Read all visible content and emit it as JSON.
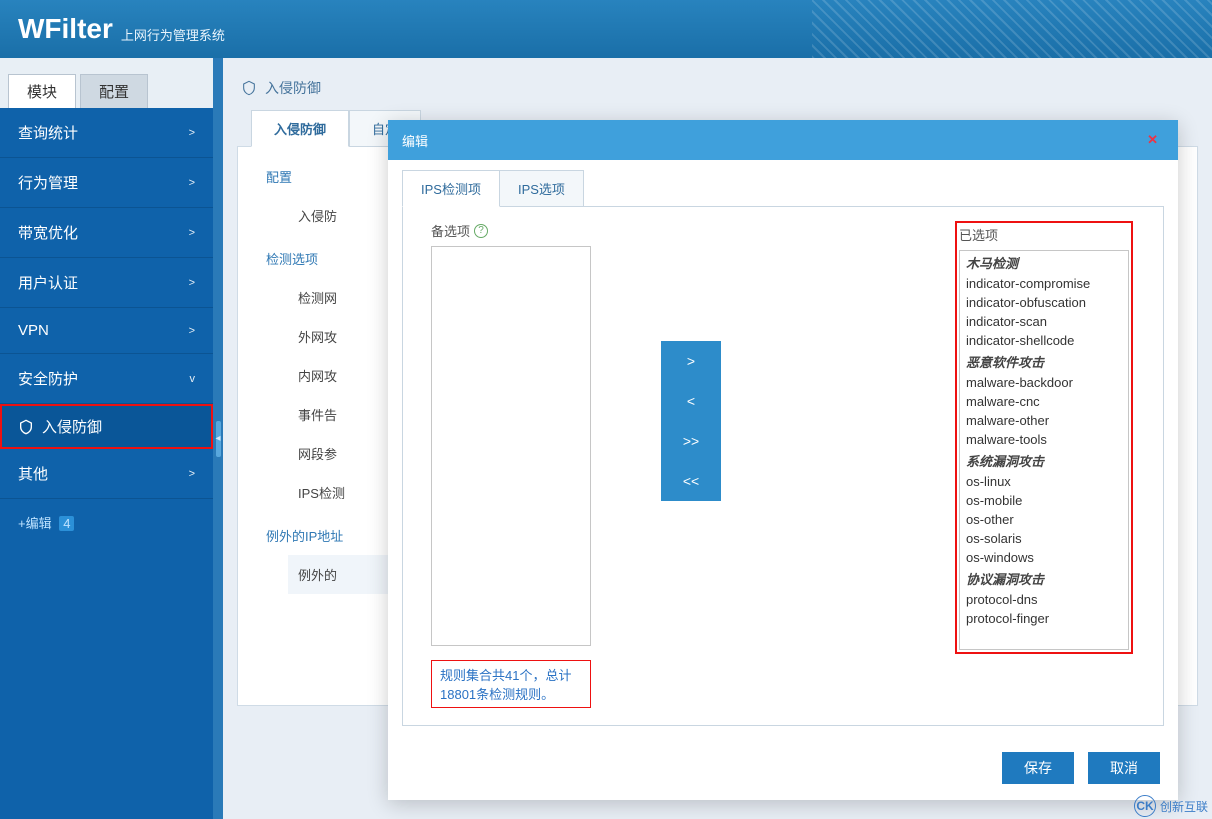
{
  "header": {
    "brand": "WFilter",
    "subtitle": "上网行为管理系统"
  },
  "side_tabs": {
    "modules": "模块",
    "config": "配置"
  },
  "menu": {
    "query": "查询统计",
    "behavior": "行为管理",
    "bandwidth": "带宽优化",
    "auth": "用户认证",
    "vpn": "VPN",
    "security": "安全防护",
    "security_sub_intrusion": "入侵防御",
    "other": "其他",
    "edit": "+编辑",
    "edit_badge": "4"
  },
  "chevron_right": ">",
  "chevron_down": "v",
  "breadcrumb": "入侵防御",
  "page_tabs": {
    "intrusion": "入侵防御",
    "custom": "自定"
  },
  "panel": {
    "section_config": "配置",
    "line_intrusion": "入侵防",
    "section_detect": "检测选项",
    "line_net": "检测网",
    "line_ext": "外网攻",
    "line_int": "内网攻",
    "line_event": "事件告",
    "line_seg": "网段参",
    "line_ips": "IPS检测",
    "section_exception": "例外的IP地址",
    "line_exception": "例外的"
  },
  "modal": {
    "title": "编辑",
    "tab_items": "IPS检测项",
    "tab_options": "IPS选项",
    "available_label": "备选项",
    "selected_label": "已选项",
    "help": "?",
    "move_right": ">",
    "move_left": "<",
    "move_all_right": ">>",
    "move_all_left": "<<",
    "rule_summary": "规则集合共41个，总计18801条检测规则。",
    "save": "保存",
    "cancel": "取消"
  },
  "selected_items": [
    {
      "label": "木马检测",
      "group": true
    },
    {
      "label": "indicator-compromise",
      "group": false
    },
    {
      "label": "indicator-obfuscation",
      "group": false
    },
    {
      "label": "indicator-scan",
      "group": false
    },
    {
      "label": "indicator-shellcode",
      "group": false
    },
    {
      "label": "恶意软件攻击",
      "group": true
    },
    {
      "label": "malware-backdoor",
      "group": false
    },
    {
      "label": "malware-cnc",
      "group": false
    },
    {
      "label": "malware-other",
      "group": false
    },
    {
      "label": "malware-tools",
      "group": false
    },
    {
      "label": "系统漏洞攻击",
      "group": true
    },
    {
      "label": "os-linux",
      "group": false
    },
    {
      "label": "os-mobile",
      "group": false
    },
    {
      "label": "os-other",
      "group": false
    },
    {
      "label": "os-solaris",
      "group": false
    },
    {
      "label": "os-windows",
      "group": false
    },
    {
      "label": "协议漏洞攻击",
      "group": true
    },
    {
      "label": "protocol-dns",
      "group": false
    },
    {
      "label": "protocol-finger",
      "group": false
    }
  ],
  "watermark": {
    "icon": "CK",
    "text": "创新互联"
  }
}
